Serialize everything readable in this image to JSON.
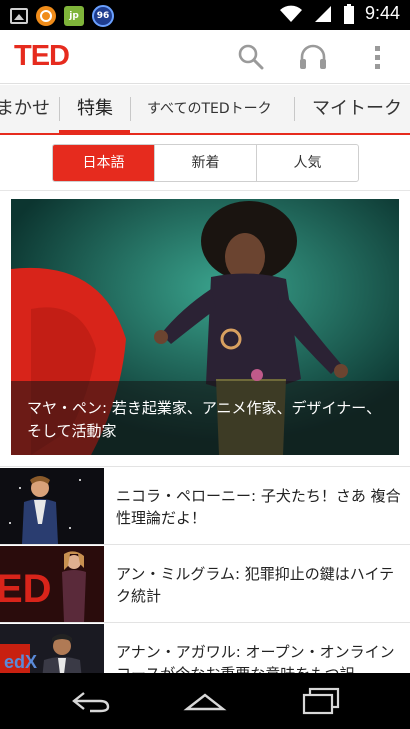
{
  "status_bar": {
    "time": "9:44",
    "badge_count": "96",
    "app_icon_label": "jp"
  },
  "app_bar": {
    "logo": "TED",
    "icons": [
      "search-icon",
      "headphones-icon",
      "overflow-menu-icon"
    ]
  },
  "tabs": [
    {
      "label": "まかせ",
      "active": false
    },
    {
      "label": "特集",
      "active": true
    },
    {
      "label": "すべてのTEDトーク",
      "active": false
    },
    {
      "label": "マイトーク",
      "active": false
    }
  ],
  "segments": [
    {
      "label": "日本語",
      "active": true
    },
    {
      "label": "新着",
      "active": false
    },
    {
      "label": "人気",
      "active": false
    }
  ],
  "featured": {
    "caption": "マヤ・ペン: 若き起業家、アニメ作家、デザイナー、そして活動家"
  },
  "talks": [
    {
      "title": "ニコラ・ペローニー: 子犬たち！さあ 複合性理論だよ！"
    },
    {
      "title": "アン・ミルグラム: 犯罪抑止の鍵はハイテク統計"
    },
    {
      "title": "アナン・アガワル: オープン・オンラインコースが今なお重要な意味をもつ訳"
    }
  ],
  "colors": {
    "brand_red": "#e62b1e",
    "tab_bg": "#f4f4f4",
    "status_bar_bg": "#000000"
  }
}
